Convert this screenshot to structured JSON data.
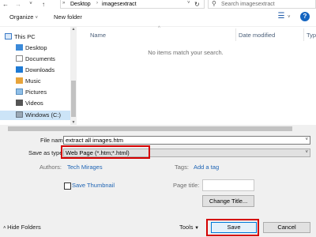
{
  "address": {
    "crumbs": [
      "Desktop",
      "imagesextract"
    ],
    "search_placeholder": "Search imagesextract"
  },
  "toolbar": {
    "organize": "Organize",
    "new_folder": "New folder",
    "help": "?"
  },
  "nav": {
    "items": [
      {
        "label": "This PC",
        "icon": "pc-icon"
      },
      {
        "label": "Desktop",
        "icon": "desktop-icon"
      },
      {
        "label": "Documents",
        "icon": "documents-icon"
      },
      {
        "label": "Downloads",
        "icon": "downloads-icon"
      },
      {
        "label": "Music",
        "icon": "music-icon"
      },
      {
        "label": "Pictures",
        "icon": "pictures-icon"
      },
      {
        "label": "Videos",
        "icon": "videos-icon"
      },
      {
        "label": "Windows (C:)",
        "icon": "drive-icon"
      }
    ]
  },
  "filelist": {
    "columns": [
      "Name",
      "Date modified",
      "Typ"
    ],
    "empty_message": "No items match your search."
  },
  "form": {
    "file_name_label": "File name:",
    "file_name_value": "extract all images.htm",
    "save_type_label": "Save as type:",
    "save_type_value": "Web Page (*.htm;*.html)",
    "authors_label": "Authors:",
    "authors_value": "Tech Mirages",
    "tags_label": "Tags:",
    "tags_value": "Add a tag",
    "thumbnail_label": "Save Thumbnail",
    "page_title_label": "Page title:",
    "change_title_button": "Change Title..."
  },
  "footer": {
    "hide_folders": "Hide Folders",
    "tools": "Tools",
    "save": "Save",
    "cancel": "Cancel"
  },
  "colors": {
    "highlight": "#d40000",
    "link": "#1e64b4",
    "selection": "#cce4f7"
  }
}
